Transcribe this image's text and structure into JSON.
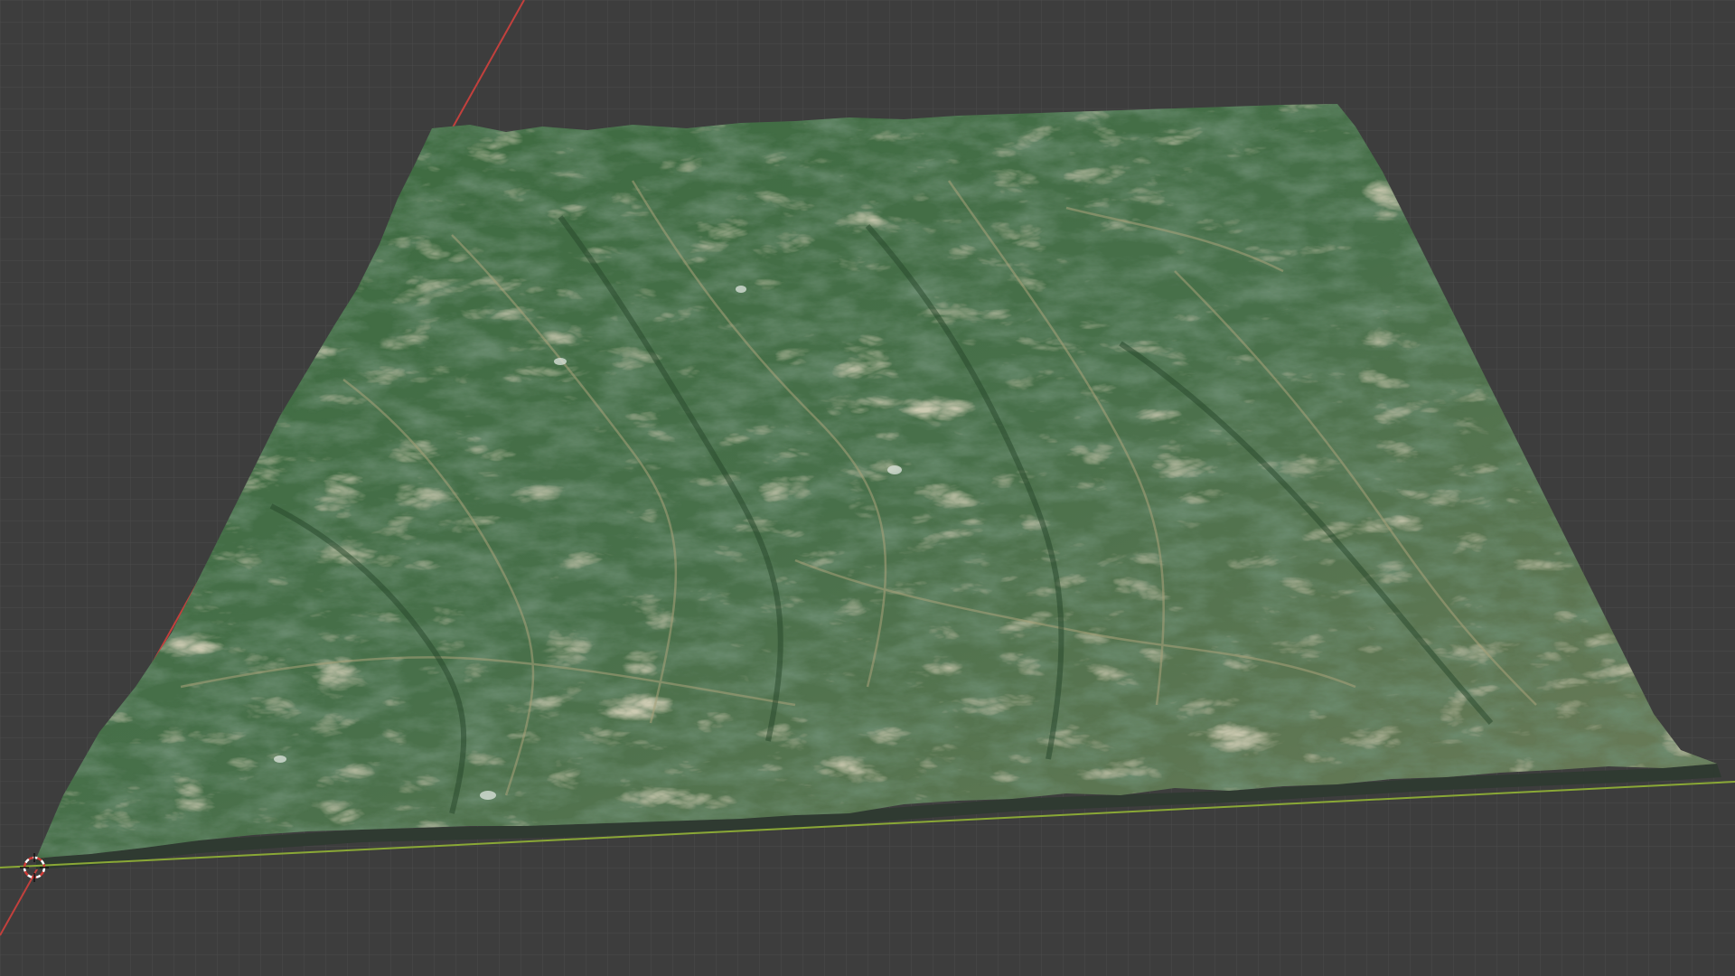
{
  "viewport": {
    "background_color": "#3d3d3d",
    "grid_line_color": "#4a4a4a",
    "x_axis_color": "#8aa836",
    "y_axis_color": "#c2403d",
    "terrain_base_color": "#3f6a3d",
    "terrain_ridge_color": "#a9a27a",
    "terrain_valley_color": "#25452a",
    "terrain_edge_color": "#2f3a31"
  },
  "icons": {
    "cursor": "3d-cursor-icon"
  }
}
